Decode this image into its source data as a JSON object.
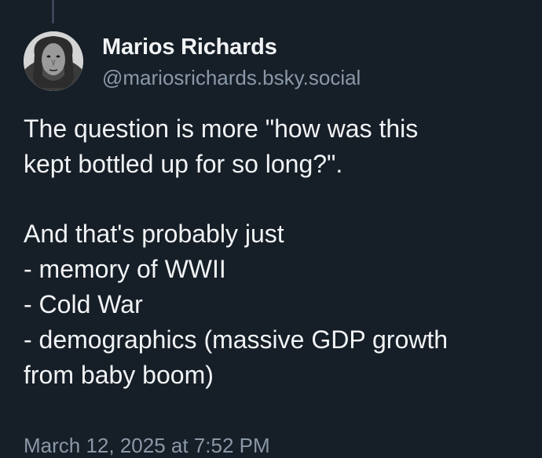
{
  "post": {
    "author": {
      "display_name": "Marios Richards",
      "handle": "@mariosrichards.bsky.social",
      "avatar_icon": "user-avatar-photo"
    },
    "text_lines": [
      "The question is more \"how was this",
      "kept bottled up for so long?\".",
      "",
      "And that's probably just",
      "- memory of WWII",
      "- Cold War",
      "- demographics (massive GDP growth",
      "from baby boom)"
    ],
    "timestamp": "March 12, 2025 at 7:52 PM"
  },
  "colors": {
    "background": "#161e27",
    "text_primary": "#f1f3f5",
    "text_secondary": "#8b98a8",
    "thread_line": "#3a4656"
  }
}
